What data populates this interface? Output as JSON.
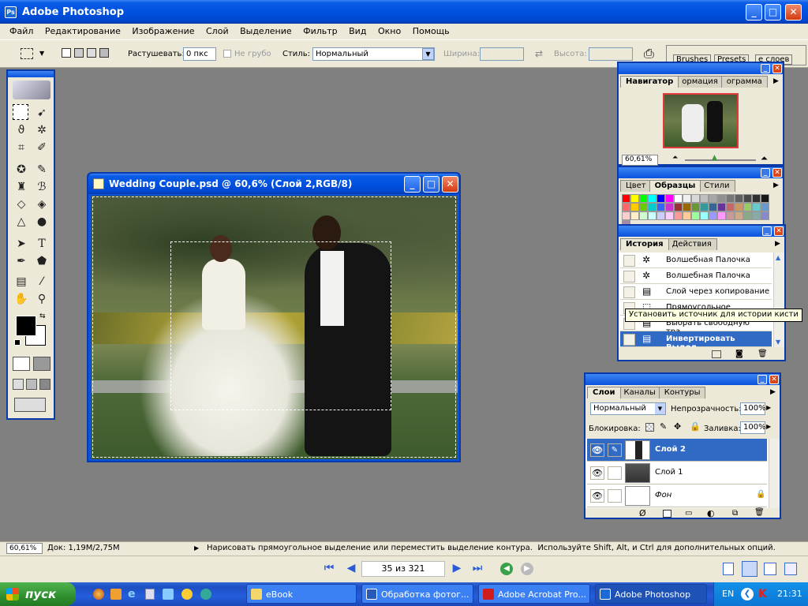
{
  "app": {
    "title": "Adobe Photoshop"
  },
  "menu": [
    "Файл",
    "Редактирование",
    "Изображение",
    "Слой",
    "Выделение",
    "Фильтр",
    "Вид",
    "Окно",
    "Помощь"
  ],
  "options": {
    "feather_label": "Растушевать:",
    "feather_value": "0 пкс",
    "antialias_label": "Не грубо",
    "style_label": "Стиль:",
    "style_value": "Нормальный",
    "width_label": "Ширина:",
    "height_label": "Высота:",
    "well_tabs": [
      "Brushes",
      "Presets",
      "е слоев"
    ]
  },
  "document": {
    "title": "Wedding Couple.psd @ 60,6% (Слой 2,RGB/8)"
  },
  "navigator": {
    "tabs": [
      "Навигатор",
      "ормация",
      "ограмма"
    ],
    "zoom": "60,61%"
  },
  "swatches_panel": {
    "tabs": [
      "Цвет",
      "Образцы",
      "Стили"
    ],
    "colors_row1": [
      "#ff0000",
      "#ffff00",
      "#00ff00",
      "#00ffff",
      "#0000ff",
      "#ff00ff",
      "#ffffff",
      "#f0f0f0",
      "#d8d8d8",
      "#c0c0c0",
      "#a8a8a8",
      "#909090",
      "#787878",
      "#606060",
      "#484848",
      "#303030",
      "#181818",
      "#000000"
    ],
    "colors_row2": [
      "#ff6666",
      "#ffcc00",
      "#66cc00",
      "#00cccc",
      "#3366ff",
      "#cc33cc",
      "#993333",
      "#996600",
      "#669933",
      "#339999",
      "#336699",
      "#663399",
      "#cc6666",
      "#cc9966",
      "#99cc66",
      "#66cccc",
      "#6699cc",
      "#9966cc"
    ],
    "colors_row3": [
      "#ffcccc",
      "#ffeecc",
      "#ccffcc",
      "#ccffff",
      "#ccccff",
      "#ffccff",
      "#ff9999",
      "#ffcc99",
      "#99ff99",
      "#99ffff",
      "#9999ff",
      "#ff99ff",
      "#cc9999",
      "#ccaa88",
      "#88aa88",
      "#88aaaa",
      "#8888cc",
      "#aa88aa"
    ]
  },
  "history": {
    "tabs": [
      "История",
      "Действия"
    ],
    "items": [
      {
        "label": "Волшебная Палочка",
        "icon": "magic-wand-icon"
      },
      {
        "label": "Волшебная Палочка",
        "icon": "magic-wand-icon"
      },
      {
        "label": "Слой через копирование",
        "icon": "layer-icon"
      },
      {
        "label": "Прямоугольное Выделение",
        "icon": "marquee-icon"
      },
      {
        "label": "Выбрать свободную тра...",
        "icon": "layer-icon"
      },
      {
        "label": "Инвертировать Выдел...",
        "icon": "layer-icon",
        "active": true
      }
    ],
    "tooltip": "Установить источник для истории кисти"
  },
  "layers": {
    "tabs": [
      "Слои",
      "Каналы",
      "Контуры"
    ],
    "blend_mode": "Нормальный",
    "opacity_label": "Непрозрачность:",
    "opacity_value": "100%",
    "lock_label": "Блокировка:",
    "fill_label": "Заливка:",
    "fill_value": "100%",
    "items": [
      {
        "name": "Слой 2",
        "selected": true
      },
      {
        "name": "Слой 1",
        "selected": false
      },
      {
        "name": "Фон",
        "selected": false,
        "locked": true
      }
    ]
  },
  "status": {
    "zoom": "60,61%",
    "doc": "Док: 1,19M/2,75M",
    "hint": "Нарисовать прямоугольное выделение или переместить выделение контура.  Используйте Shift, Alt, и Ctrl для дополнительных опций."
  },
  "pager": {
    "text": "35 из 321"
  },
  "taskbar": {
    "start": "пуск",
    "tasks": [
      "eBook",
      "Обработка фотог...",
      "Adobe Acrobat Pro...",
      "Adobe Photoshop"
    ],
    "lang": "EN",
    "clock": "21:31"
  }
}
